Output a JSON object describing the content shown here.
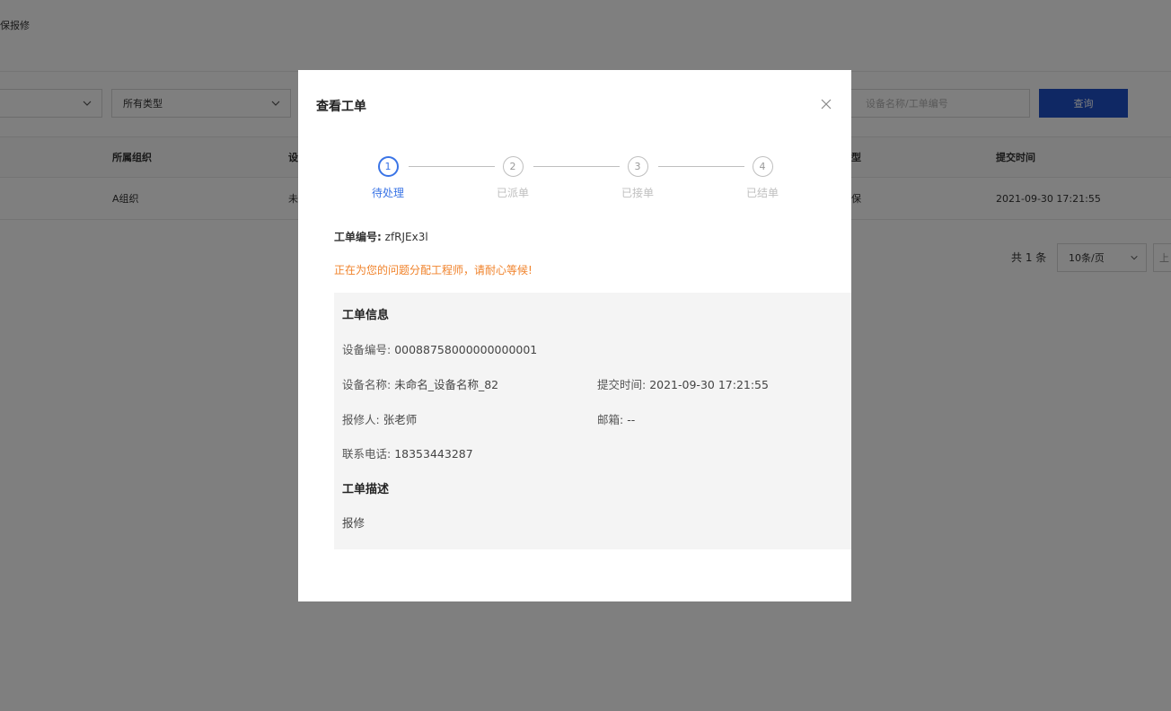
{
  "breadcrumb": "保报修",
  "filters": {
    "select1_value": "",
    "select2_value": "所有类型",
    "search_placeholder": "设备名称/工单编号",
    "query_label": "查询"
  },
  "table": {
    "headers": [
      "所属组织",
      "设",
      "型",
      "提交时间"
    ],
    "rows": [
      [
        "A组织",
        "未",
        "保",
        "2021-09-30 17:21:55"
      ]
    ]
  },
  "pagination": {
    "total": "共 1 条",
    "page_size": "10条/页",
    "prev": "上"
  },
  "modal": {
    "title": "查看工单",
    "steps": [
      {
        "num": "1",
        "label": "待处理",
        "active": true
      },
      {
        "num": "2",
        "label": "已派单",
        "active": false
      },
      {
        "num": "3",
        "label": "已接单",
        "active": false
      },
      {
        "num": "4",
        "label": "已结单",
        "active": false
      }
    ],
    "order_no_label": "工单编号:",
    "order_no_value": "zfRJEx3l",
    "notice": "正在为您的问题分配工程师，请耐心等候!",
    "info_title": "工单信息",
    "device_no_label": "设备编号:",
    "device_no_value": "00088758000000000001",
    "device_name_label": "设备名称:",
    "device_name_value": "未命名_设备名称_82",
    "submit_time_label": "提交时间:",
    "submit_time_value": "2021-09-30 17:21:55",
    "reporter_label": "报修人:",
    "reporter_value": "张老师",
    "email_label": "邮箱:",
    "email_value": "--",
    "phone_label": "联系电话:",
    "phone_value": "18353443287",
    "desc_title": "工单描述",
    "desc_value": "报修"
  },
  "colors": {
    "accent": "#3a74e6",
    "button": "#1e50c8",
    "notice": "#f0822a"
  }
}
